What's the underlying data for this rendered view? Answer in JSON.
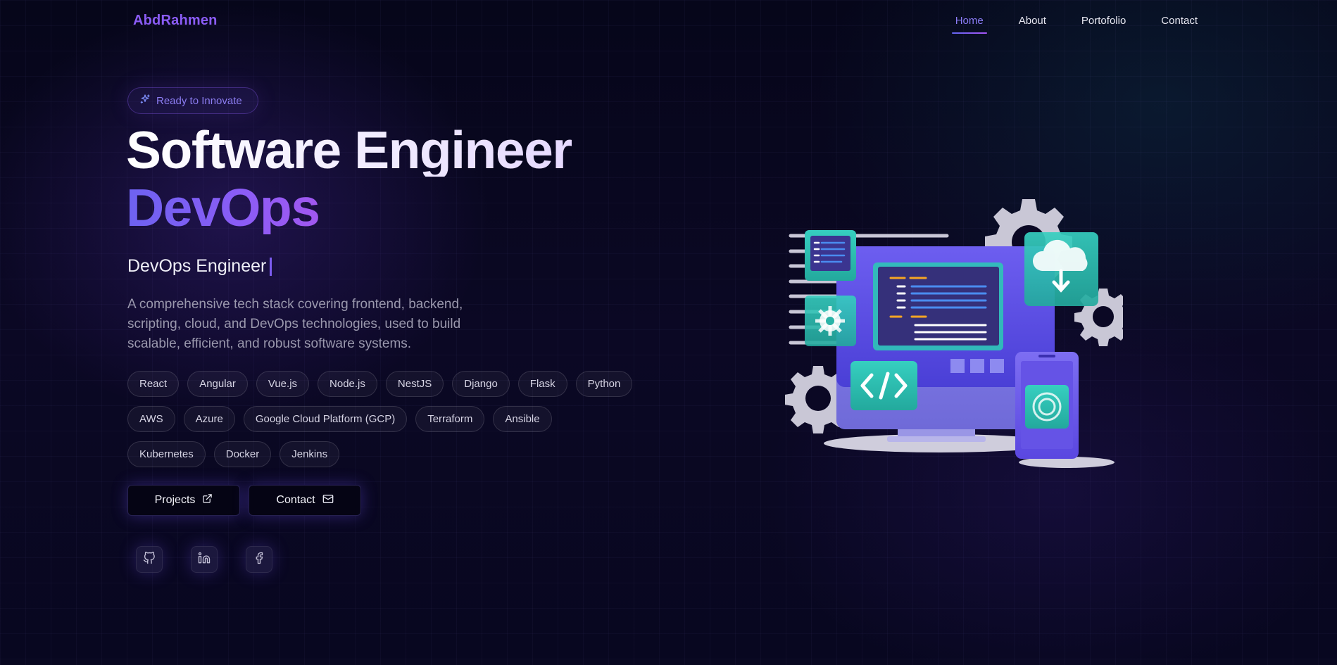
{
  "nav": {
    "logo": "AbdRahmen",
    "links": [
      {
        "label": "Home",
        "active": true
      },
      {
        "label": "About",
        "active": false
      },
      {
        "label": "Portofolio",
        "active": false
      },
      {
        "label": "Contact",
        "active": false
      }
    ]
  },
  "hero": {
    "badge": "Ready to Innovate",
    "title_line1": "Software Engineer",
    "title_line2": "DevOps",
    "role": "DevOps Engineer",
    "description": "A comprehensive tech stack covering frontend, backend, scripting, cloud, and DevOps technologies, used to build scalable, efficient, and robust software systems.",
    "tags_row1": [
      "React",
      "Angular",
      "Vue.js",
      "Node.js",
      "NestJS",
      "Django",
      "Flask",
      "Python"
    ],
    "tags_row2": [
      "AWS",
      "Azure",
      "Google Cloud Platform (GCP)",
      "Terraform",
      "Ansible"
    ],
    "tags_row3": [
      "Kubernetes",
      "Docker",
      "Jenkins"
    ],
    "buttons": {
      "projects": "Projects",
      "contact": "Contact"
    },
    "socials": [
      {
        "icon": "github-icon"
      },
      {
        "icon": "linkedin-icon"
      },
      {
        "icon": "facebook-icon"
      }
    ]
  },
  "colors": {
    "accent": "#8b5cf6",
    "background": "#07061a",
    "teal": "#2ec4b6"
  }
}
